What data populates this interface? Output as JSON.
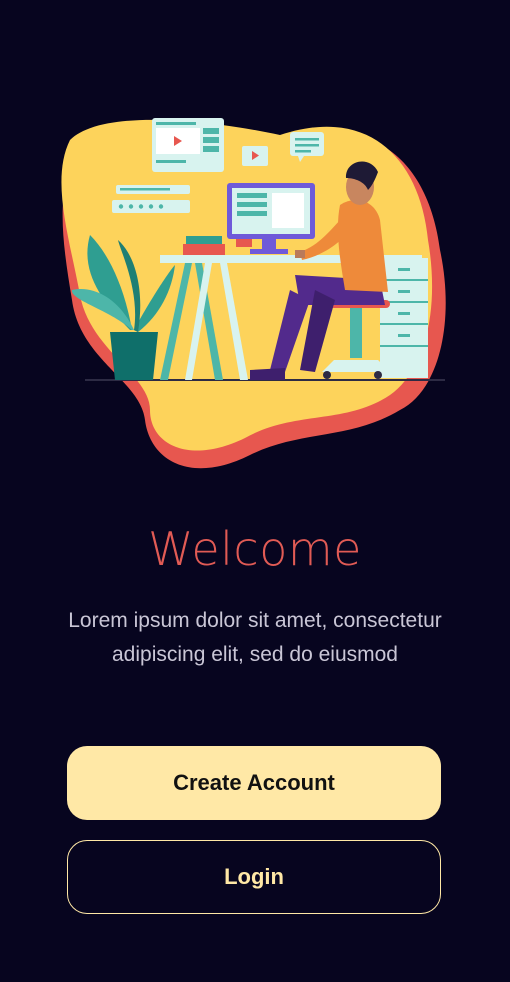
{
  "welcome": {
    "title": "Welcome",
    "subtitle": "Lorem ipsum dolor sit amet, consectetur adipiscing elit, sed do eiusmod"
  },
  "actions": {
    "create_account_label": "Create Account",
    "login_label": "Login"
  },
  "colors": {
    "background": "#07051f",
    "title": "#e15b55",
    "accent": "#ffe8a6",
    "blob_yellow": "#fdd35b",
    "blob_red": "#e7574f"
  },
  "illustration": {
    "name": "person-working-at-desk-illustration"
  }
}
